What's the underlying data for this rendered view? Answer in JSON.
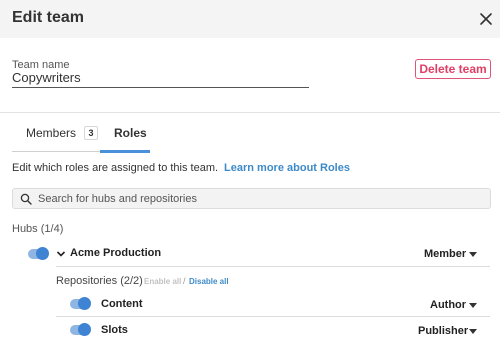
{
  "modal": {
    "title": "Edit team",
    "close_icon": "close-icon"
  },
  "team_name": {
    "label": "Team name",
    "value": "Copywriters"
  },
  "delete_button": {
    "label": "Delete team",
    "color": "#e03f66"
  },
  "tabs": [
    {
      "label": "Members",
      "count": "3",
      "active": false
    },
    {
      "label": "Roles",
      "active": true
    }
  ],
  "roles_description": {
    "text": "Edit which roles are assigned to this team.",
    "link": "Learn more about Roles"
  },
  "search": {
    "placeholder": "Search for hubs and repositories",
    "value": "",
    "icon": "search-icon"
  },
  "hubs": {
    "heading": "Hubs (1/4)",
    "items": [
      {
        "name": "Acme Production",
        "enabled": true,
        "expanded": true,
        "role": "Member",
        "repositories_heading": "Repositories (2/2)",
        "enable_all": "Enable all",
        "separator": "/",
        "disable_all": "Disable all",
        "repositories": [
          {
            "name": "Content",
            "enabled": true,
            "role": "Author"
          },
          {
            "name": "Slots",
            "enabled": true,
            "role": "Publisher"
          }
        ]
      }
    ]
  },
  "colors": {
    "accent": "#4a90d9",
    "link": "#3d8ac8",
    "toggle_on": "#3f84d3",
    "danger": "#e03f66"
  }
}
